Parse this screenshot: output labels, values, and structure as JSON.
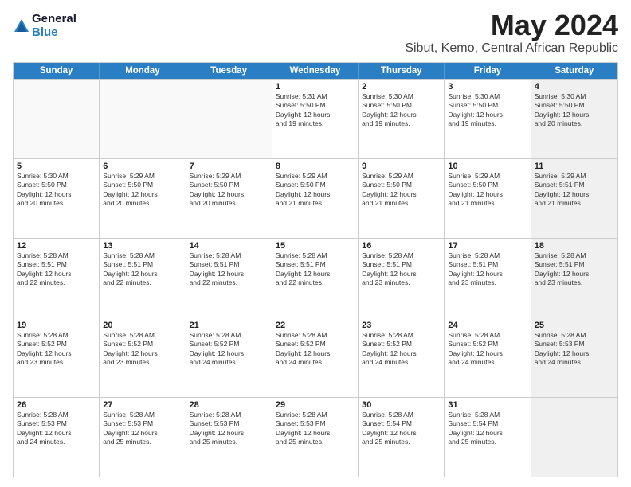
{
  "logo": {
    "general": "General",
    "blue": "Blue"
  },
  "title": {
    "month": "May 2024",
    "location": "Sibut, Kemo, Central African Republic"
  },
  "header_days": [
    "Sunday",
    "Monday",
    "Tuesday",
    "Wednesday",
    "Thursday",
    "Friday",
    "Saturday"
  ],
  "weeks": [
    [
      {
        "day": "",
        "info": "",
        "empty": true
      },
      {
        "day": "",
        "info": "",
        "empty": true
      },
      {
        "day": "",
        "info": "",
        "empty": true
      },
      {
        "day": "1",
        "info": "Sunrise: 5:31 AM\nSunset: 5:50 PM\nDaylight: 12 hours\nand 19 minutes.",
        "empty": false
      },
      {
        "day": "2",
        "info": "Sunrise: 5:30 AM\nSunset: 5:50 PM\nDaylight: 12 hours\nand 19 minutes.",
        "empty": false
      },
      {
        "day": "3",
        "info": "Sunrise: 5:30 AM\nSunset: 5:50 PM\nDaylight: 12 hours\nand 19 minutes.",
        "empty": false
      },
      {
        "day": "4",
        "info": "Sunrise: 5:30 AM\nSunset: 5:50 PM\nDaylight: 12 hours\nand 20 minutes.",
        "empty": false,
        "shaded": true
      }
    ],
    [
      {
        "day": "5",
        "info": "Sunrise: 5:30 AM\nSunset: 5:50 PM\nDaylight: 12 hours\nand 20 minutes.",
        "empty": false
      },
      {
        "day": "6",
        "info": "Sunrise: 5:29 AM\nSunset: 5:50 PM\nDaylight: 12 hours\nand 20 minutes.",
        "empty": false
      },
      {
        "day": "7",
        "info": "Sunrise: 5:29 AM\nSunset: 5:50 PM\nDaylight: 12 hours\nand 20 minutes.",
        "empty": false
      },
      {
        "day": "8",
        "info": "Sunrise: 5:29 AM\nSunset: 5:50 PM\nDaylight: 12 hours\nand 21 minutes.",
        "empty": false
      },
      {
        "day": "9",
        "info": "Sunrise: 5:29 AM\nSunset: 5:50 PM\nDaylight: 12 hours\nand 21 minutes.",
        "empty": false
      },
      {
        "day": "10",
        "info": "Sunrise: 5:29 AM\nSunset: 5:50 PM\nDaylight: 12 hours\nand 21 minutes.",
        "empty": false
      },
      {
        "day": "11",
        "info": "Sunrise: 5:29 AM\nSunset: 5:51 PM\nDaylight: 12 hours\nand 21 minutes.",
        "empty": false,
        "shaded": true
      }
    ],
    [
      {
        "day": "12",
        "info": "Sunrise: 5:28 AM\nSunset: 5:51 PM\nDaylight: 12 hours\nand 22 minutes.",
        "empty": false
      },
      {
        "day": "13",
        "info": "Sunrise: 5:28 AM\nSunset: 5:51 PM\nDaylight: 12 hours\nand 22 minutes.",
        "empty": false
      },
      {
        "day": "14",
        "info": "Sunrise: 5:28 AM\nSunset: 5:51 PM\nDaylight: 12 hours\nand 22 minutes.",
        "empty": false
      },
      {
        "day": "15",
        "info": "Sunrise: 5:28 AM\nSunset: 5:51 PM\nDaylight: 12 hours\nand 22 minutes.",
        "empty": false
      },
      {
        "day": "16",
        "info": "Sunrise: 5:28 AM\nSunset: 5:51 PM\nDaylight: 12 hours\nand 23 minutes.",
        "empty": false
      },
      {
        "day": "17",
        "info": "Sunrise: 5:28 AM\nSunset: 5:51 PM\nDaylight: 12 hours\nand 23 minutes.",
        "empty": false
      },
      {
        "day": "18",
        "info": "Sunrise: 5:28 AM\nSunset: 5:51 PM\nDaylight: 12 hours\nand 23 minutes.",
        "empty": false,
        "shaded": true
      }
    ],
    [
      {
        "day": "19",
        "info": "Sunrise: 5:28 AM\nSunset: 5:52 PM\nDaylight: 12 hours\nand 23 minutes.",
        "empty": false
      },
      {
        "day": "20",
        "info": "Sunrise: 5:28 AM\nSunset: 5:52 PM\nDaylight: 12 hours\nand 23 minutes.",
        "empty": false
      },
      {
        "day": "21",
        "info": "Sunrise: 5:28 AM\nSunset: 5:52 PM\nDaylight: 12 hours\nand 24 minutes.",
        "empty": false
      },
      {
        "day": "22",
        "info": "Sunrise: 5:28 AM\nSunset: 5:52 PM\nDaylight: 12 hours\nand 24 minutes.",
        "empty": false
      },
      {
        "day": "23",
        "info": "Sunrise: 5:28 AM\nSunset: 5:52 PM\nDaylight: 12 hours\nand 24 minutes.",
        "empty": false
      },
      {
        "day": "24",
        "info": "Sunrise: 5:28 AM\nSunset: 5:52 PM\nDaylight: 12 hours\nand 24 minutes.",
        "empty": false
      },
      {
        "day": "25",
        "info": "Sunrise: 5:28 AM\nSunset: 5:53 PM\nDaylight: 12 hours\nand 24 minutes.",
        "empty": false,
        "shaded": true
      }
    ],
    [
      {
        "day": "26",
        "info": "Sunrise: 5:28 AM\nSunset: 5:53 PM\nDaylight: 12 hours\nand 24 minutes.",
        "empty": false
      },
      {
        "day": "27",
        "info": "Sunrise: 5:28 AM\nSunset: 5:53 PM\nDaylight: 12 hours\nand 25 minutes.",
        "empty": false
      },
      {
        "day": "28",
        "info": "Sunrise: 5:28 AM\nSunset: 5:53 PM\nDaylight: 12 hours\nand 25 minutes.",
        "empty": false
      },
      {
        "day": "29",
        "info": "Sunrise: 5:28 AM\nSunset: 5:53 PM\nDaylight: 12 hours\nand 25 minutes.",
        "empty": false
      },
      {
        "day": "30",
        "info": "Sunrise: 5:28 AM\nSunset: 5:54 PM\nDaylight: 12 hours\nand 25 minutes.",
        "empty": false
      },
      {
        "day": "31",
        "info": "Sunrise: 5:28 AM\nSunset: 5:54 PM\nDaylight: 12 hours\nand 25 minutes.",
        "empty": false
      },
      {
        "day": "",
        "info": "",
        "empty": true,
        "shaded": true
      }
    ]
  ]
}
